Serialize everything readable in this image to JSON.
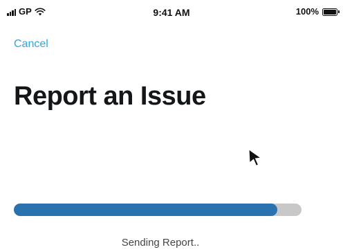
{
  "status_bar": {
    "carrier": "GP",
    "time": "9:41 AM",
    "battery": "100%",
    "signal_bars": 4,
    "icons": [
      "signal-icon",
      "wifi-icon",
      "battery-icon"
    ]
  },
  "nav": {
    "cancel_label": "Cancel"
  },
  "page": {
    "title": "Report an Issue"
  },
  "progress": {
    "fraction": 0.915,
    "label": "Sending Report.."
  },
  "colors": {
    "accent": "#2ea8e0",
    "progress_fill": "#2a71b0",
    "progress_track": "#c8c8c8",
    "title": "#14171a"
  }
}
